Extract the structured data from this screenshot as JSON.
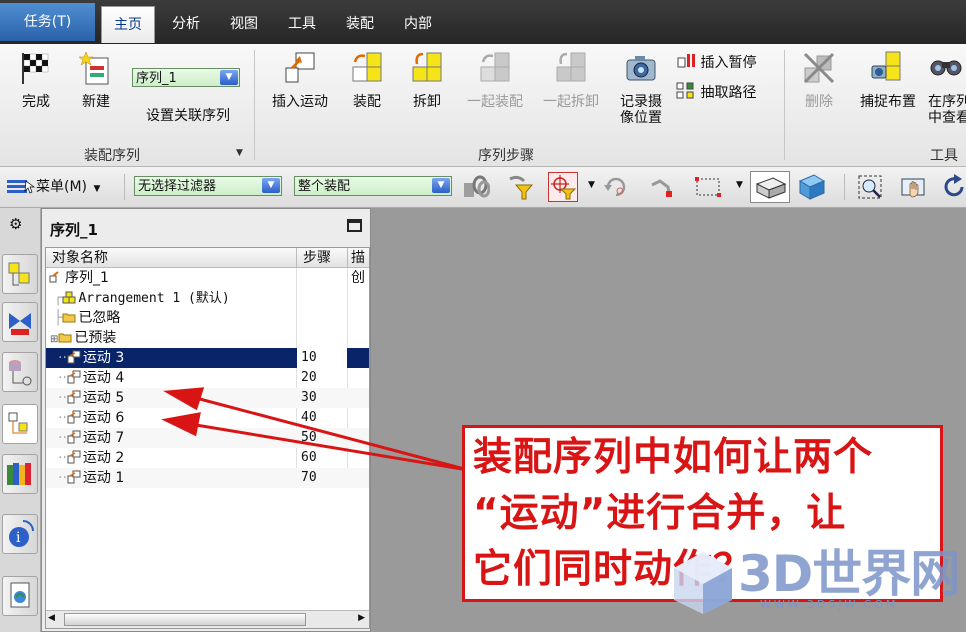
{
  "tabbar": {
    "task_tab": "任务(T)",
    "tabs": [
      "主页",
      "分析",
      "视图",
      "工具",
      "装配",
      "内部"
    ]
  },
  "ribbon": {
    "group1": {
      "done": "完成",
      "new": "新建",
      "sequence_select": "序列_1",
      "set_related": "设置关联序列",
      "label": "装配序列"
    },
    "group2": {
      "insert_motion": "插入运动",
      "assemble": "装配",
      "disassemble": "拆卸",
      "assemble_together": "一起装配",
      "disassemble_together": "一起拆卸",
      "record_camera_line1": "记录摄",
      "record_camera_line2": "像位置",
      "insert_pause": "插入暂停",
      "extract_path": "抽取路径",
      "label": "序列步骤"
    },
    "group3": {
      "delete": "删除",
      "capture_layout": "捕捉布置",
      "find_in_sequence_line1": "在序列",
      "find_in_sequence_line2": "中查看",
      "label": "工具"
    }
  },
  "toolbar": {
    "menu": "菜单(M)",
    "filter": "无选择过滤器",
    "scope": "整个装配"
  },
  "navigator": {
    "title": "序列_1",
    "columns": [
      "对象名称",
      "步骤",
      "描"
    ],
    "rows": [
      {
        "name": "序列_1",
        "step": "",
        "desc": "创",
        "indent": 0
      },
      {
        "name": "Arrangement 1 (默认)",
        "step": "",
        "desc": "",
        "indent": 1
      },
      {
        "name": "已忽略",
        "step": "",
        "desc": "",
        "indent": 1
      },
      {
        "name": "已预装",
        "step": "",
        "desc": "",
        "indent": 1
      },
      {
        "name": "运动 3",
        "step": "10",
        "desc": "",
        "indent": 2,
        "selected": true
      },
      {
        "name": "运动 4",
        "step": "20",
        "desc": "",
        "indent": 2
      },
      {
        "name": "运动 5",
        "step": "30",
        "desc": "",
        "indent": 2
      },
      {
        "name": "运动 6",
        "step": "40",
        "desc": "",
        "indent": 2
      },
      {
        "name": "运动 7",
        "step": "50",
        "desc": "",
        "indent": 2
      },
      {
        "name": "运动 2",
        "step": "60",
        "desc": "",
        "indent": 2
      },
      {
        "name": "运动 1",
        "step": "70",
        "desc": "",
        "indent": 2
      }
    ]
  },
  "annotation": {
    "line1": "装配序列中如何让两个",
    "line2": "“运动”进行合并，让",
    "line3": "它们同时动作？"
  },
  "watermark": {
    "logo": "3D世界网",
    "url": "WWW.3DSJW.COM"
  },
  "colors": {
    "selection": "#0a246a",
    "annotation_red": "#d81414",
    "ribbon_tab_blue": "#2a61a8"
  }
}
